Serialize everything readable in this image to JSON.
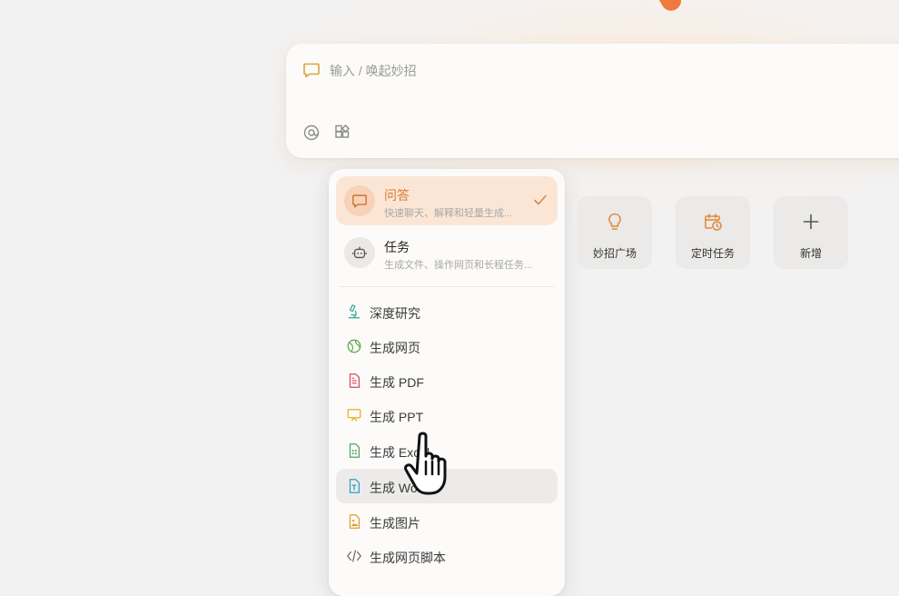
{
  "input": {
    "placeholder": "输入 / 唤起妙招",
    "value": ""
  },
  "toolbar": {
    "mention_icon": "at-icon",
    "apps_icon": "apps-icon"
  },
  "menu": {
    "modes": [
      {
        "title": "问答",
        "desc": "快速聊天、解释和轻量生成...",
        "icon": "chat-bubble-icon",
        "selected": true
      },
      {
        "title": "任务",
        "desc": "生成文件、操作网页和长程任务...",
        "icon": "robot-icon",
        "selected": false
      }
    ],
    "generate_items": [
      {
        "label": "深度研究",
        "icon": "microscope-icon",
        "color": "#3aa59a"
      },
      {
        "label": "生成网页",
        "icon": "globe-icon",
        "color": "#5fa64a"
      },
      {
        "label": "生成 PDF",
        "icon": "pdf-file-icon",
        "color": "#d9485f"
      },
      {
        "label": "生成 PPT",
        "icon": "presentation-icon",
        "color": "#e0b21c"
      },
      {
        "label": "生成 Excel",
        "icon": "spreadsheet-icon",
        "color": "#4ea55c"
      },
      {
        "label": "生成 Word",
        "icon": "word-doc-icon",
        "color": "#2f9fc9"
      },
      {
        "label": "生成图片",
        "icon": "image-file-icon",
        "color": "#e89a2c"
      },
      {
        "label": "生成网页脚本",
        "icon": "code-icon",
        "color": "#6b6b6b"
      }
    ]
  },
  "quick_actions": [
    {
      "label": "妙招广场",
      "icon": "lightbulb-icon"
    },
    {
      "label": "定时任务",
      "icon": "calendar-clock-icon"
    },
    {
      "label": "新增",
      "icon": "plus-icon"
    }
  ],
  "colors": {
    "accent": "#e08a3c",
    "selected_bg": "#fbe6d6"
  }
}
